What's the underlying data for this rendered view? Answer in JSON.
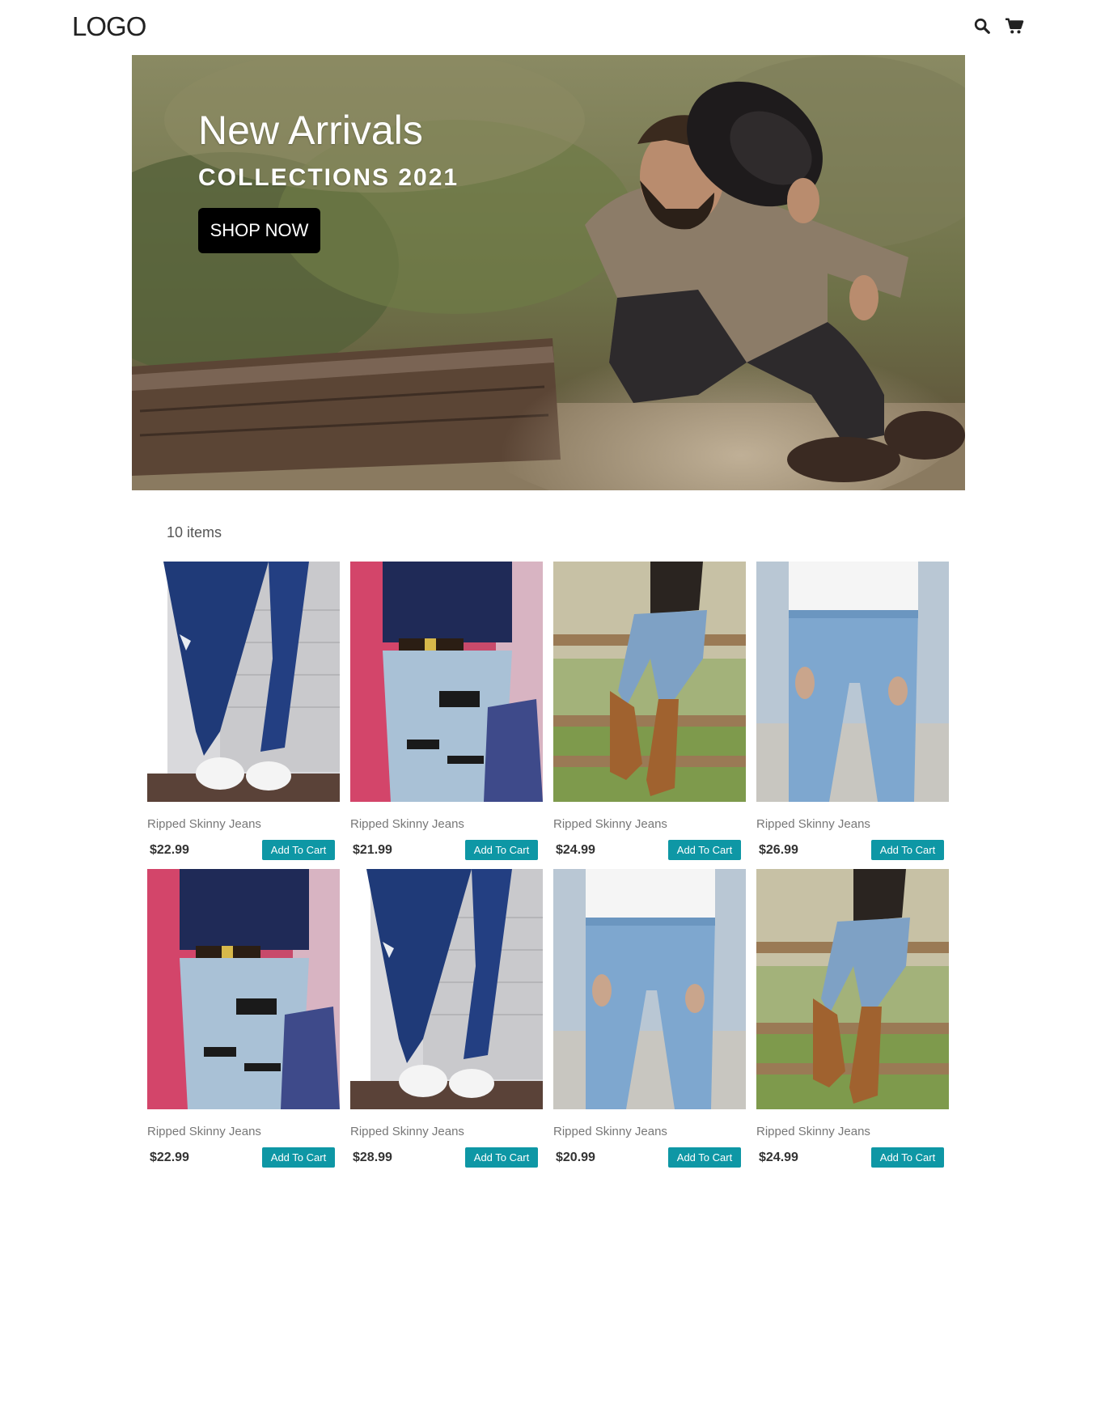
{
  "header": {
    "logo": "LOGO",
    "icons": [
      "search-icon",
      "cart-icon"
    ]
  },
  "hero": {
    "title": "New Arrivals",
    "subtitle": "COLLECTIONS 2021",
    "button_label": "SHOP NOW"
  },
  "listing": {
    "count_label": "10 items"
  },
  "colors": {
    "accent": "#0e97a5",
    "hero_button": "#000000"
  },
  "products": [
    {
      "name": "Ripped Skinny Jeans",
      "price": "$22.99",
      "button": "Add To Cart",
      "image": "dark-blue-ripped-jeans-sneakers"
    },
    {
      "name": "Ripped Skinny Jeans",
      "price": "$21.99",
      "button": "Add To Cart",
      "image": "light-distressed-jeans-colorful-wall"
    },
    {
      "name": "Ripped Skinny Jeans",
      "price": "$24.99",
      "button": "Add To Cart",
      "image": "jeans-cowboy-boots-fence"
    },
    {
      "name": "Ripped Skinny Jeans",
      "price": "$26.99",
      "button": "Add To Cart",
      "image": "light-blue-jeans-white-shirt"
    },
    {
      "name": "Ripped Skinny Jeans",
      "price": "$22.99",
      "button": "Add To Cart",
      "image": "light-distressed-jeans-colorful-wall"
    },
    {
      "name": "Ripped Skinny Jeans",
      "price": "$28.99",
      "button": "Add To Cart",
      "image": "dark-blue-ripped-jeans-sneakers"
    },
    {
      "name": "Ripped Skinny Jeans",
      "price": "$20.99",
      "button": "Add To Cart",
      "image": "light-blue-jeans-white-shirt"
    },
    {
      "name": "Ripped Skinny Jeans",
      "price": "$24.99",
      "button": "Add To Cart",
      "image": "jeans-cowboy-boots-fence"
    }
  ]
}
